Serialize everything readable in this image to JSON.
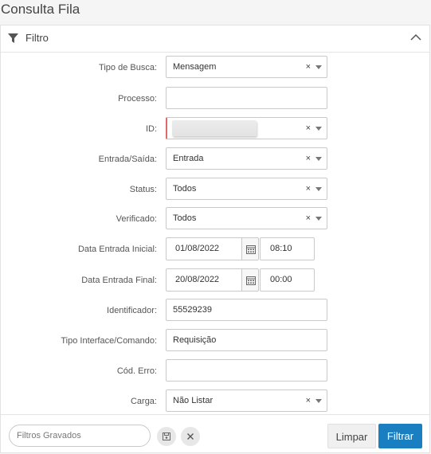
{
  "page": {
    "title": "Consulta Fila"
  },
  "panel": {
    "title": "Filtro"
  },
  "form": {
    "tipo_busca": {
      "label": "Tipo de Busca:",
      "value": "Mensagem"
    },
    "processo": {
      "label": "Processo:",
      "value": ""
    },
    "id": {
      "label": "ID:",
      "value": ""
    },
    "entrada_saida": {
      "label": "Entrada/Saída:",
      "value": "Entrada"
    },
    "status": {
      "label": "Status:",
      "value": "Todos"
    },
    "verificado": {
      "label": "Verificado:",
      "value": "Todos"
    },
    "data_inicial": {
      "label": "Data Entrada Inicial:",
      "date": "01/08/2022",
      "time": "08:10"
    },
    "data_final": {
      "label": "Data Entrada Final:",
      "date": "20/08/2022",
      "time": "00:00"
    },
    "identificador": {
      "label": "Identificador:",
      "value": "55529239"
    },
    "tipo_interface": {
      "label": "Tipo Interface/Comando:",
      "value": "Requisição"
    },
    "cod_erro": {
      "label": "Cód. Erro:",
      "value": ""
    },
    "carga": {
      "label": "Carga:",
      "value": "Não Listar"
    },
    "clear_symbol": "×"
  },
  "footer": {
    "saved_filters_placeholder": "Filtros Gravados",
    "clear_label": "Limpar",
    "filter_label": "Filtrar"
  },
  "colors": {
    "primary": "#1a7fc0",
    "invalid_marker": "#e06a6a"
  },
  "icons": [
    "filter-icon",
    "chevron-up-icon",
    "calendar-icon",
    "save-icon",
    "close-icon",
    "caret-down-icon"
  ]
}
